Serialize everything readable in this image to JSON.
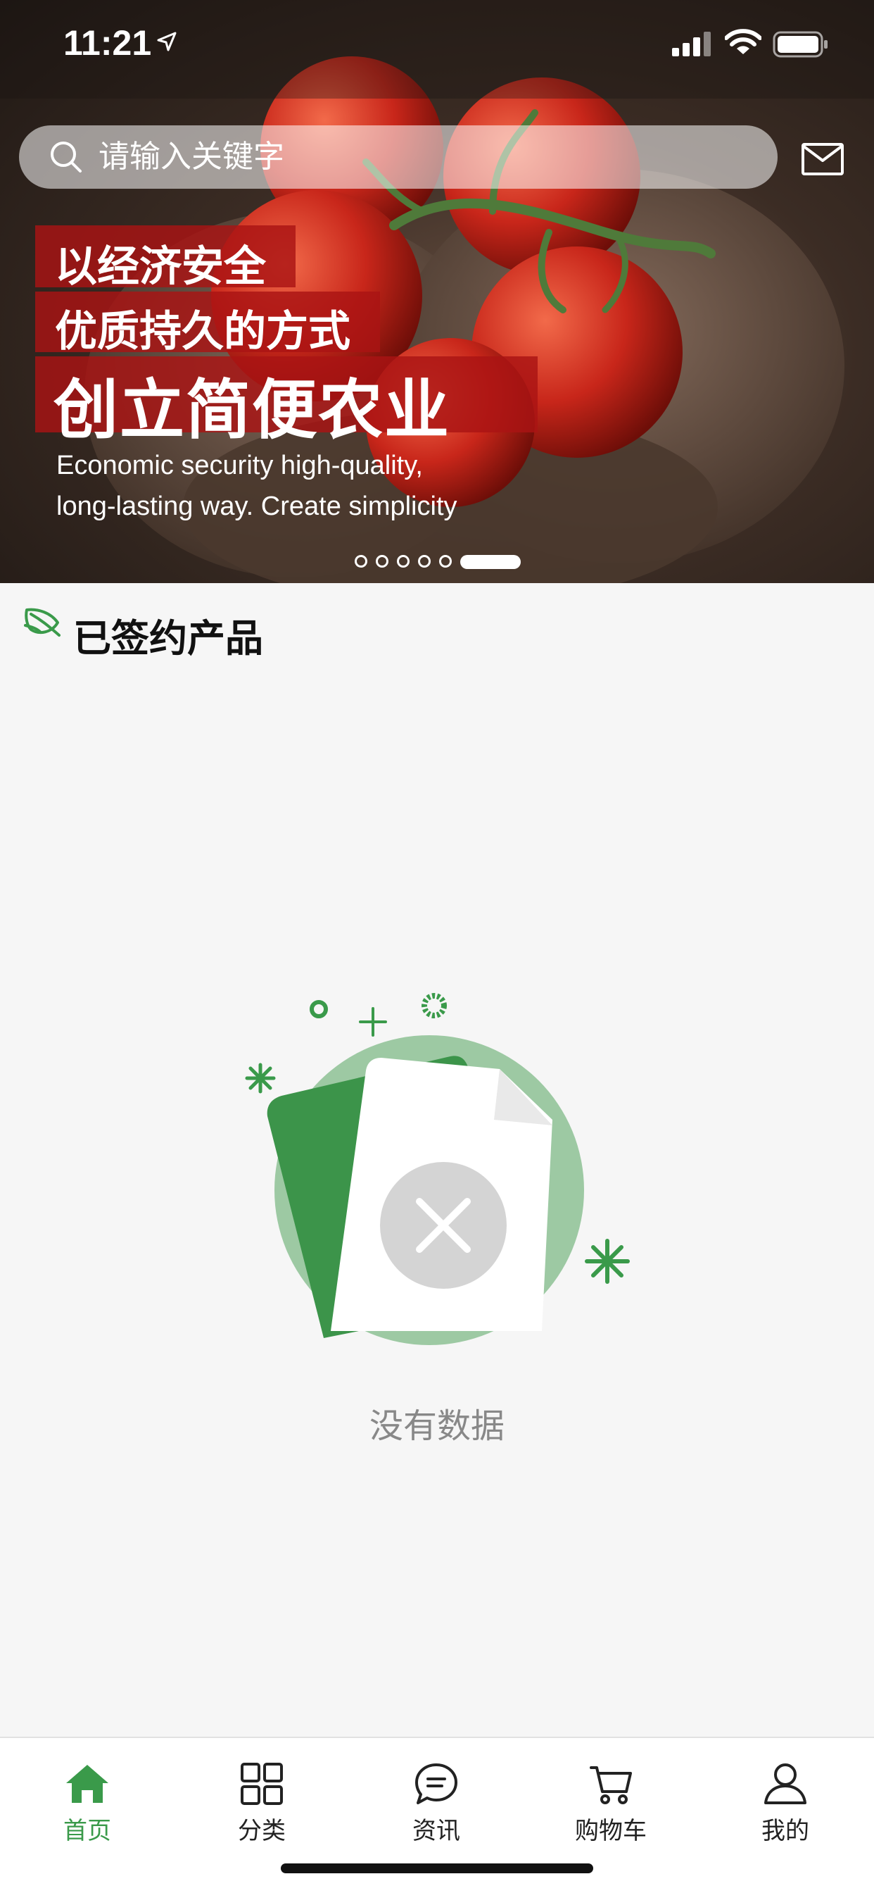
{
  "status_bar": {
    "time": "11:21"
  },
  "search": {
    "placeholder": "请输入关键字"
  },
  "banner": {
    "headline_1": "以经济安全",
    "headline_2": "优质持久的方式",
    "headline_3": "创立简便农业",
    "english_line_1": "Economic security high-quality,",
    "english_line_2": "long-lasting way. Create simplicity",
    "slide_count": 6,
    "active_slide": 6
  },
  "section": {
    "title": "已签约产品",
    "icon": "leaf-icon"
  },
  "empty_state": {
    "text": "没有数据",
    "icon": "no-data-document-icon"
  },
  "tab_bar": {
    "tabs": [
      {
        "label": "首页",
        "icon": "home-icon",
        "active": true
      },
      {
        "label": "分类",
        "icon": "grid-icon",
        "active": false
      },
      {
        "label": "资讯",
        "icon": "chat-bubble-icon",
        "active": false
      },
      {
        "label": "购物车",
        "icon": "cart-icon",
        "active": false
      },
      {
        "label": "我的",
        "icon": "user-icon",
        "active": false
      }
    ]
  },
  "colors": {
    "accent_green": "#3a9a4a",
    "banner_red": "#aa1414",
    "background": "#f6f6f6"
  }
}
